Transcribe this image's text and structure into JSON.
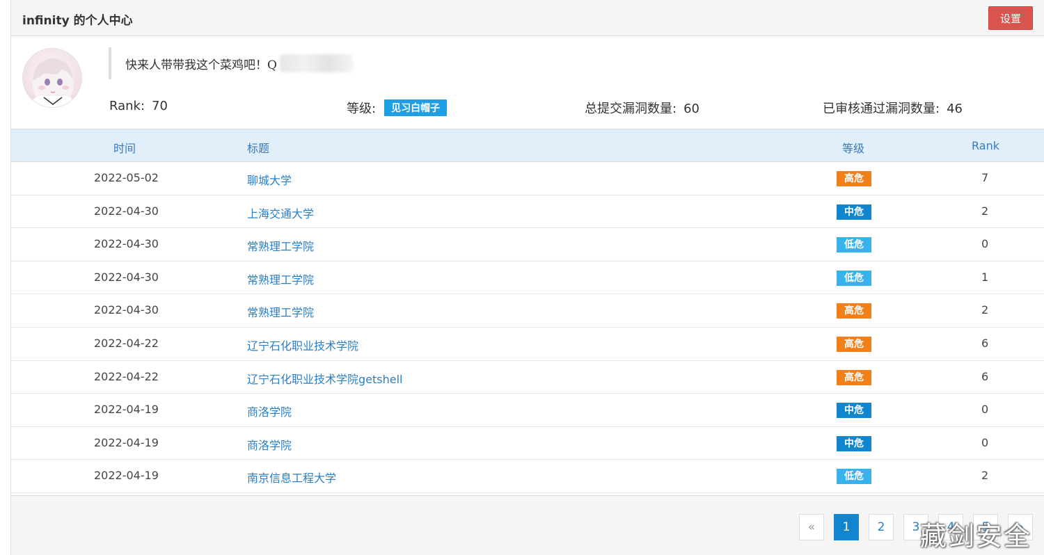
{
  "header": {
    "title": "infinity 的个人中心",
    "settings_label": "设置"
  },
  "profile": {
    "avatar_icon": "avatar-anime-girl",
    "signature": "快来人带带我这个菜鸡吧！Q",
    "rank_label": "Rank:",
    "rank_value": "70",
    "level_label": "等级:",
    "level_value": "见习白帽子",
    "submitted_label": "总提交漏洞数量:",
    "submitted_value": "60",
    "approved_label": "已审核通过漏洞数量:",
    "approved_value": "46"
  },
  "table": {
    "columns": [
      "时间",
      "标题",
      "等级",
      "Rank"
    ],
    "rows": [
      {
        "date": "2022-05-02",
        "title": "聊城大学",
        "level": "高危",
        "rank": "7"
      },
      {
        "date": "2022-04-30",
        "title": "上海交通大学",
        "level": "中危",
        "rank": "2"
      },
      {
        "date": "2022-04-30",
        "title": "常熟理工学院",
        "level": "低危",
        "rank": "0"
      },
      {
        "date": "2022-04-30",
        "title": "常熟理工学院",
        "level": "低危",
        "rank": "1"
      },
      {
        "date": "2022-04-30",
        "title": "常熟理工学院",
        "level": "高危",
        "rank": "2"
      },
      {
        "date": "2022-04-22",
        "title": "辽宁石化职业技术学院",
        "level": "高危",
        "rank": "6"
      },
      {
        "date": "2022-04-22",
        "title": "辽宁石化职业技术学院getshell",
        "level": "高危",
        "rank": "6"
      },
      {
        "date": "2022-04-19",
        "title": "商洛学院",
        "level": "中危",
        "rank": "0"
      },
      {
        "date": "2022-04-19",
        "title": "商洛学院",
        "level": "中危",
        "rank": "0"
      },
      {
        "date": "2022-04-19",
        "title": "南京信息工程大学",
        "level": "低危",
        "rank": "2"
      }
    ]
  },
  "severity_colors": {
    "高危": "#f07f1c",
    "中危": "#1186cf",
    "低危": "#38b2ec"
  },
  "pagination": {
    "prev_label": "«",
    "pages": [
      "1",
      "2",
      "3",
      "4",
      "5"
    ],
    "next_label": "»",
    "current": "1"
  },
  "watermark": "藏剑安全"
}
